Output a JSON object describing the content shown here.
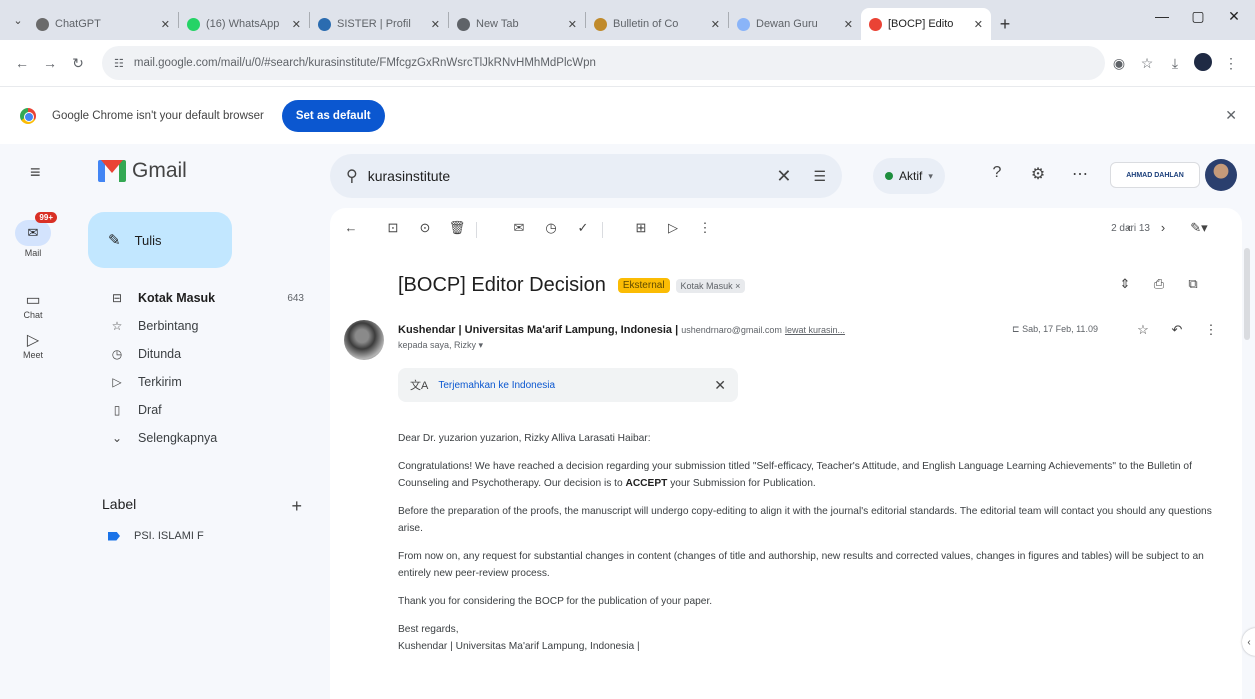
{
  "browser": {
    "tabs": [
      {
        "title": "ChatGPT",
        "icon": "chatgpt-icon",
        "color": "#6b6b6b"
      },
      {
        "title": "(16) WhatsApp",
        "icon": "whatsapp-icon",
        "color": "#25d366"
      },
      {
        "title": "SISTER | Profil",
        "icon": "sister-icon",
        "color": "#2b6cb0"
      },
      {
        "title": "New Tab",
        "icon": "new-tab-icon",
        "color": "#5f6368"
      },
      {
        "title": "Bulletin of Co",
        "icon": "journal-icon",
        "color": "#c08a2b"
      },
      {
        "title": "Dewan Guru",
        "icon": "docs-icon",
        "color": "#8ab4f8"
      },
      {
        "title": "[BOCP] Edito",
        "icon": "gmail-icon",
        "color": "#ea4335"
      }
    ],
    "url": "mail.google.com/mail/u/0/#search/kurasinstitute/FMfcgzGxRnWsrcTlJkRNvHMhMdPlcWpn"
  },
  "infobar": {
    "message": "Google Chrome isn't your default browser",
    "button": "Set as default"
  },
  "gmail": {
    "app_name": "Gmail",
    "search_query": "kurasinstitute",
    "status": "Aktif",
    "org_logo": "AHMAD DAHLAN",
    "rail": [
      {
        "label": "Mail",
        "badge": "99+"
      },
      {
        "label": "Chat"
      },
      {
        "label": "Meet"
      }
    ],
    "compose": "Tulis",
    "nav": [
      {
        "label": "Kotak Masuk",
        "count": "643",
        "icon": "inbox-icon"
      },
      {
        "label": "Berbintang",
        "count": "",
        "icon": "star-icon"
      },
      {
        "label": "Ditunda",
        "count": "",
        "icon": "clock-icon"
      },
      {
        "label": "Terkirim",
        "count": "",
        "icon": "send-icon"
      },
      {
        "label": "Draf",
        "count": "",
        "icon": "draft-icon"
      },
      {
        "label": "Selengkapnya",
        "count": "",
        "icon": "chevron-down-icon"
      }
    ],
    "labels_header": "Label",
    "labels": [
      {
        "name": "PSI. ISLAMI F",
        "color": "#1a73e8"
      }
    ]
  },
  "message": {
    "pager": "2 dari 13",
    "subject": "[BOCP] Editor Decision",
    "chip_external": "Eksternal",
    "chip_inbox": "Kotak Masuk ×",
    "sender_name": "Kushendar | Universitas Ma'arif Lampung, Indonesia |",
    "sender_email": "ushendrnaro@gmail.com",
    "via": "lewat kurasin...",
    "date": "Sab, 17 Feb, 11.09",
    "recipients": "kepada saya, Rizky ▾",
    "translate": "Terjemahkan ke Indonesia",
    "greeting": "Dear Dr. yuzarion yuzarion, Rizky Alliva Larasati Haibar:",
    "p1_before": "Congratulations! We have reached a decision regarding your submission titled \"Self-efficacy, Teacher's Attitude, and English Language Learning Achievements\" to the Bulletin of Counseling and Psychotherapy. Our decision is to ",
    "p1_bold": "ACCEPT",
    "p1_after": " your Submission for Publication.",
    "p2": "Before the preparation of the proofs, the manuscript will undergo copy-editing to align it with the journal's editorial standards. The editorial team will contact you should any questions arise.",
    "p3": "From now on, any request for substantial changes in content (changes of title and authorship, new results and corrected values, changes in figures and tables) will be subject to an entirely new peer-review process.",
    "p4": "Thank you for considering the BOCP for the publication of your paper.",
    "closing": "Best regards,",
    "signature": "Kushendar | Universitas Ma'arif Lampung, Indonesia |"
  }
}
